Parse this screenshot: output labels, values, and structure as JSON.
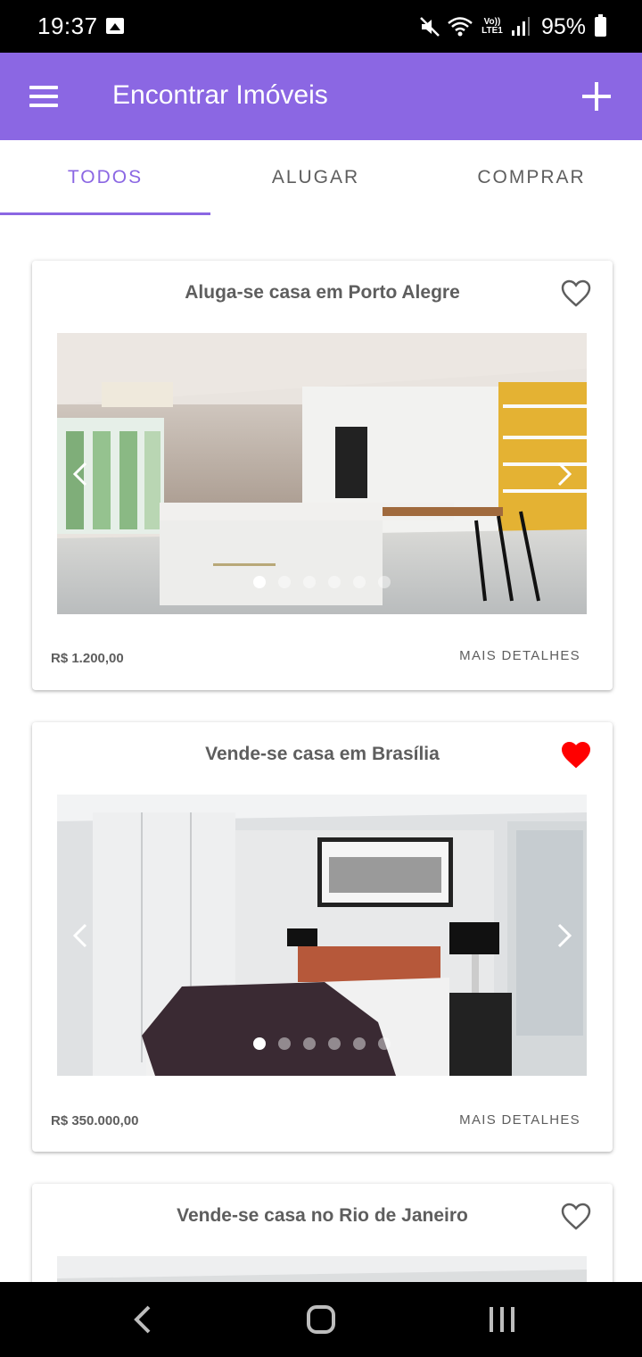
{
  "status_bar": {
    "time": "19:37",
    "battery": "95%",
    "network_label": "Vo)) LTE1",
    "icons": [
      "gallery-icon",
      "mute-icon",
      "wifi-icon",
      "signal-icon",
      "battery-icon"
    ]
  },
  "app_bar": {
    "title": "Encontrar Imóveis",
    "menu_icon": "hamburger-menu-icon",
    "add_icon": "plus-icon"
  },
  "tabs": {
    "items": [
      {
        "label": "TODOS",
        "active": true
      },
      {
        "label": "ALUGAR",
        "active": false
      },
      {
        "label": "COMPRAR",
        "active": false
      }
    ]
  },
  "listings": [
    {
      "title": "Aluga-se casa em Porto Alegre",
      "price": "R$ 1.200,00",
      "details_label": "MAIS DETALHES",
      "favorite": false,
      "image_scene": "kitchen",
      "image_count": 6,
      "current_image": 1
    },
    {
      "title": "Vende-se casa em Brasília",
      "price": "R$ 350.000,00",
      "details_label": "MAIS DETALHES",
      "favorite": true,
      "image_scene": "bedroom",
      "image_count": 6,
      "current_image": 1
    },
    {
      "title": "Vende-se casa no Rio de Janeiro",
      "favorite": false,
      "image_scene": "room"
    }
  ],
  "colors": {
    "primary": "#8b67e3",
    "favorite_active": "#ff0000",
    "text_secondary": "#5e5e5e"
  },
  "nav_bar": {
    "icons": [
      "back-icon",
      "home-icon",
      "recent-apps-icon"
    ]
  }
}
